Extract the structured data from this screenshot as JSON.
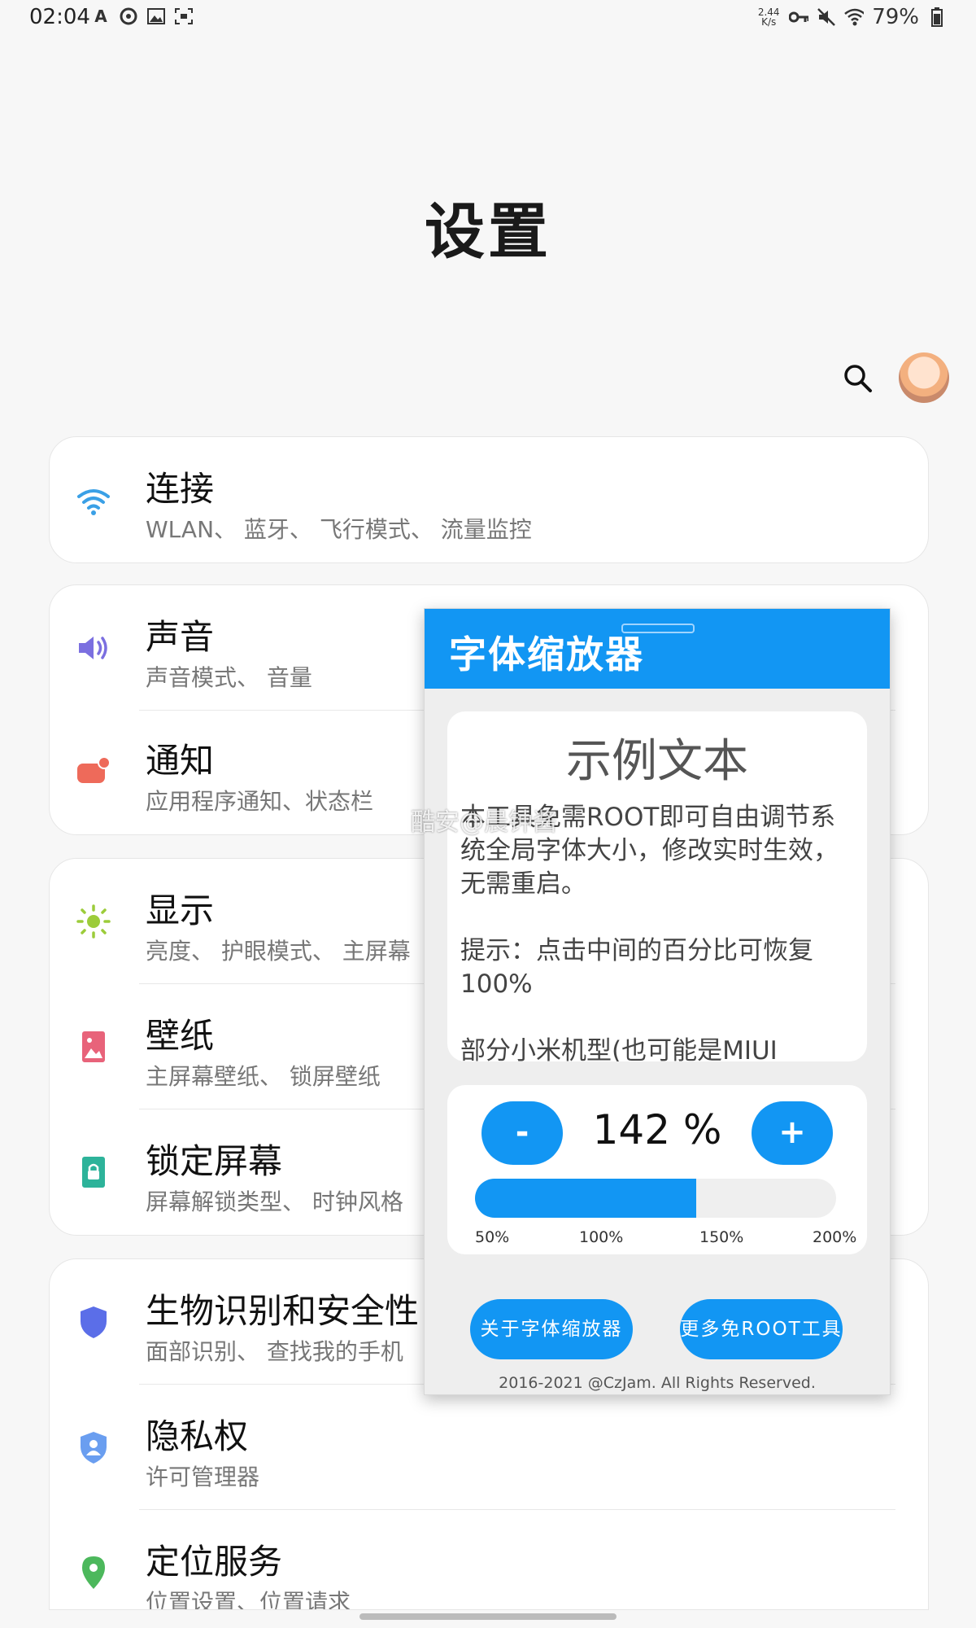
{
  "status_bar": {
    "time": "02:04",
    "left_icons": [
      "font-a-icon",
      "circle-icon",
      "image-icon",
      "screenshot-icon"
    ],
    "net_speed_value": "2.44",
    "net_speed_unit": "K/s",
    "right_icons": [
      "vpn-key-icon",
      "mute-icon",
      "wifi-icon"
    ],
    "battery": "79%"
  },
  "header": {
    "title": "设置"
  },
  "settings": [
    {
      "label": "连接",
      "sub": "WLAN、 蓝牙、 飞行模式、 流量监控",
      "icon": "wifi-icon"
    },
    {
      "label": "声音",
      "sub": "声音模式、 音量",
      "icon": "speaker-icon"
    },
    {
      "label": "通知",
      "sub": "应用程序通知、状态栏",
      "icon": "notification-icon"
    },
    {
      "label": "显示",
      "sub": "亮度、 护眼模式、 主屏幕",
      "icon": "brightness-icon"
    },
    {
      "label": "壁纸",
      "sub": "主屏幕壁纸、 锁屏壁纸",
      "icon": "wallpaper-icon"
    },
    {
      "label": "锁定屏幕",
      "sub": "屏幕解锁类型、 时钟风格",
      "icon": "lock-icon"
    },
    {
      "label": "生物识别和安全性",
      "sub": "面部识别、 查找我的手机",
      "icon": "shield-icon"
    },
    {
      "label": "隐私权",
      "sub": "许可管理器",
      "icon": "privacy-shield-icon"
    },
    {
      "label": "定位服务",
      "sub": "位置设置、位置请求",
      "icon": "location-pin-icon"
    }
  ],
  "popup": {
    "title": "字体缩放器",
    "sample_title": "示例文本",
    "sample_paragraphs": [
      "本工具免需ROOT即可自由调节系统全局字体大小，修改实时生效，无需重启。",
      "提示：点击中间的百分比可恢复100%",
      "部分小米机型(也可能是MIUI"
    ],
    "minus_label": "-",
    "plus_label": "+",
    "percent_text": "142 %",
    "scale": {
      "min": 50,
      "max": 200,
      "value": 142
    },
    "ticks": [
      "50%",
      "100%",
      "150%",
      "200%"
    ],
    "about_button": "关于字体缩放器",
    "more_button": "更多免ROOT工具",
    "copyright": "2016-2021 @CzJam. All Rights Reserved."
  },
  "watermark": "酷安@晨钟酱",
  "colors": {
    "accent": "#1296f3",
    "background": "#f7f7f7"
  }
}
